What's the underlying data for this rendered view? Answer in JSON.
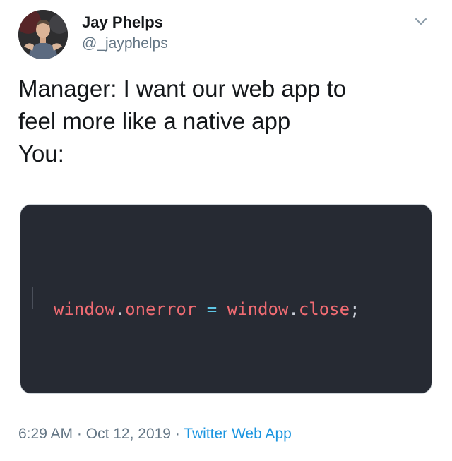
{
  "tweet": {
    "author": {
      "display_name": "Jay Phelps",
      "handle": "@_jayphelps"
    },
    "text_lines": [
      "Manager: I want our web app to",
      "feel more like a native app",
      "You:"
    ],
    "media": {
      "code_tokens": [
        {
          "text": "window",
          "kind": "ident"
        },
        {
          "text": ".",
          "kind": "punct"
        },
        {
          "text": "onerror",
          "kind": "ident"
        },
        {
          "text": " = ",
          "kind": "op"
        },
        {
          "text": "window",
          "kind": "ident"
        },
        {
          "text": ".",
          "kind": "punct"
        },
        {
          "text": "close",
          "kind": "ident"
        },
        {
          "text": ";",
          "kind": "punct"
        }
      ],
      "background_color": "#262a33",
      "identifier_color": "#f16c73",
      "operator_color": "#5fc7e6"
    },
    "meta": {
      "time": "6:29 AM",
      "separator": " · ",
      "date": "Oct 12, 2019",
      "source": "Twitter Web App"
    }
  },
  "icons": {
    "menu": "chevron-down-icon",
    "avatar": "profile-photo"
  },
  "colors": {
    "primary_text": "#14171a",
    "secondary_text": "#657786",
    "link": "#1b95e0"
  }
}
